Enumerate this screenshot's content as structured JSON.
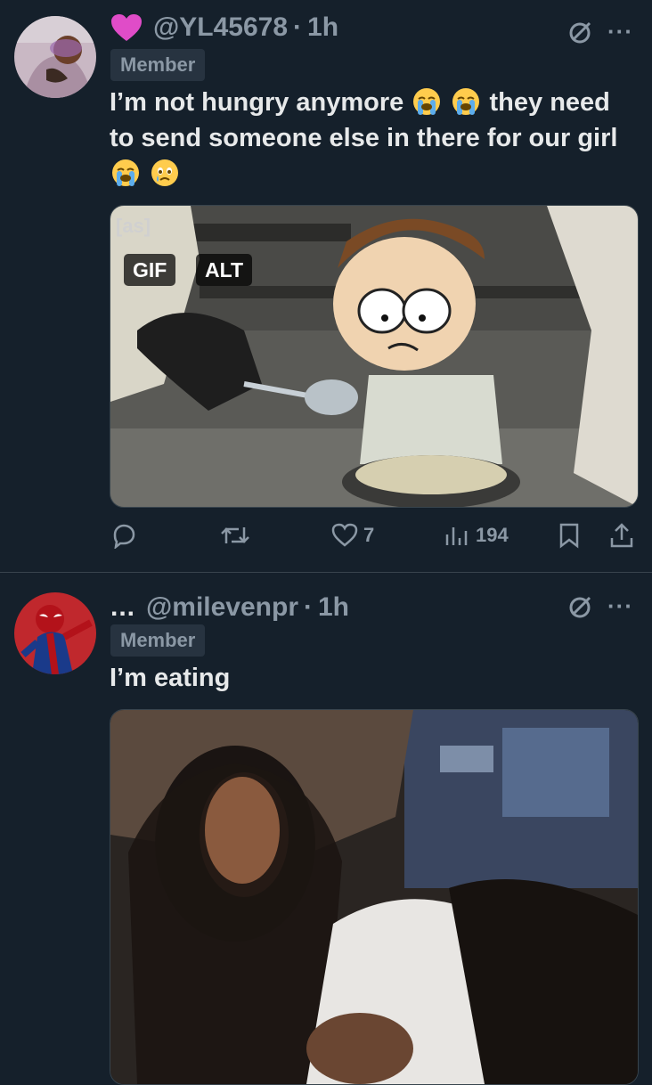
{
  "posts": [
    {
      "handle": "@YL45678",
      "separator": "·",
      "time": "1h",
      "badge": "Member",
      "text_parts": [
        "I’m not hungry anymore",
        "they need to send someone else in there for our girl"
      ],
      "media": {
        "watermark": "[as]",
        "badges": [
          "GIF",
          "ALT"
        ]
      },
      "actions": {
        "replies": "",
        "reposts": "",
        "likes": "7",
        "views": "194"
      },
      "more_icon": "more-horizontal-icon"
    },
    {
      "prefix": "...",
      "handle": "@milevenpr",
      "separator": "·",
      "time": "1h",
      "badge": "Member",
      "text": "I’m eating",
      "more_icon": "more-horizontal-icon"
    }
  ],
  "colors": {
    "background": "#15202b",
    "text": "#e7e9ea",
    "muted": "#8b98a5",
    "divider": "#38444d",
    "badge_bg": "#273340",
    "heart": "#e04cc8"
  },
  "more_glyph": "···"
}
